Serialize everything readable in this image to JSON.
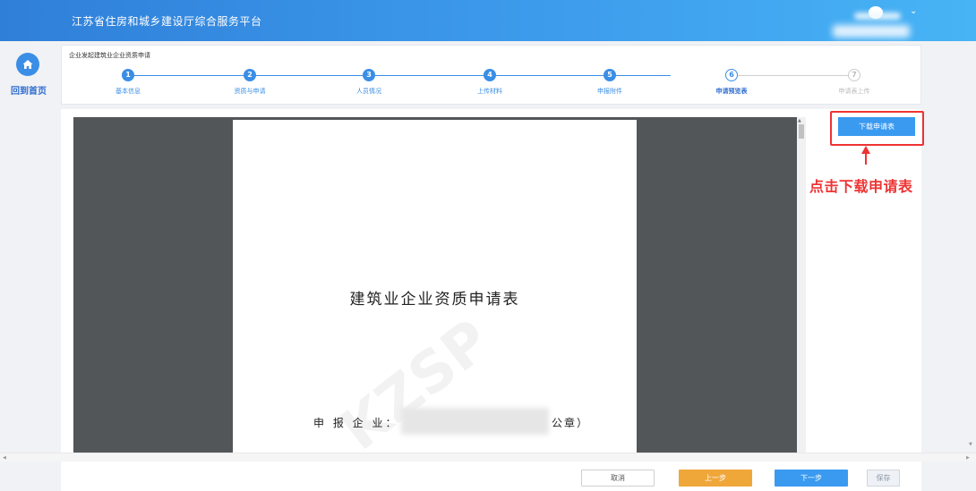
{
  "app": {
    "title": "江苏省住房和城乡建设厅综合服务平台"
  },
  "nav": {
    "home_label": "回到首页"
  },
  "steps": {
    "title": "企业发起建筑业企业资质申请",
    "items": [
      {
        "num": "1",
        "label": "基本信息",
        "state": "done"
      },
      {
        "num": "2",
        "label": "资质与申请",
        "state": "done"
      },
      {
        "num": "3",
        "label": "人员情况",
        "state": "done"
      },
      {
        "num": "4",
        "label": "上传材料",
        "state": "done"
      },
      {
        "num": "5",
        "label": "申报附件",
        "state": "done"
      },
      {
        "num": "6",
        "label": "申请预览表",
        "state": "active"
      },
      {
        "num": "7",
        "label": "申请表上传",
        "state": "pending"
      }
    ]
  },
  "preview": {
    "doc_title": "建筑业企业资质申请表",
    "applicant_label": "申 报 企 业：",
    "applicant_suffix": "公章）",
    "watermark": "KZSP"
  },
  "download": {
    "button_label": "下载申请表",
    "annotation": "点击下载申请表"
  },
  "footer": {
    "cancel": "取消",
    "prev": "上一步",
    "next": "下一步",
    "save": "保存"
  },
  "colors": {
    "primary": "#3a8ee6",
    "accent_orange": "#f0a73a",
    "annotation_red": "#ee3333"
  }
}
